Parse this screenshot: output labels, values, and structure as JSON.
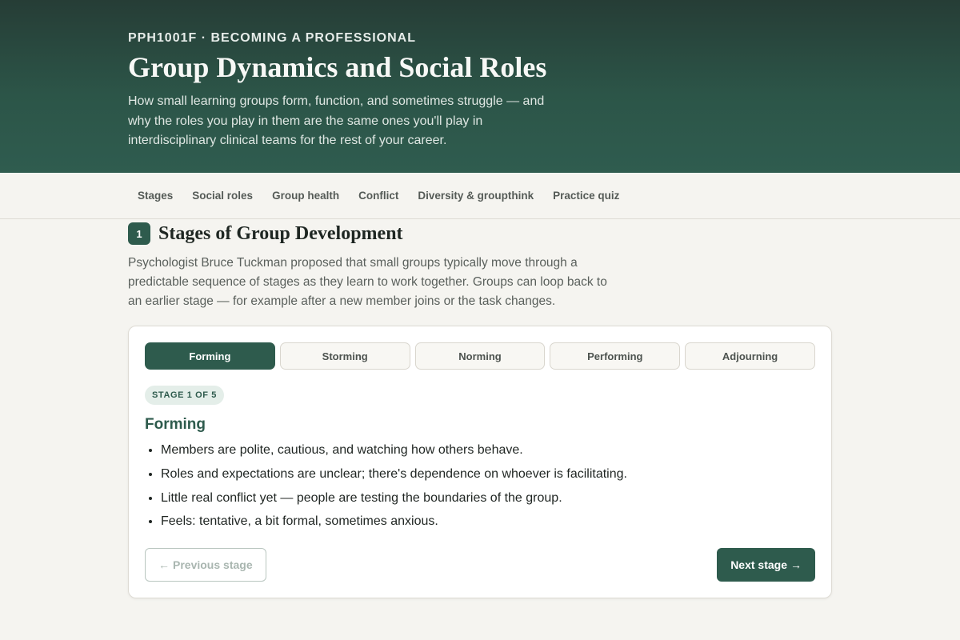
{
  "hero": {
    "course_code": "PPH1001F · BECOMING A PROFESSIONAL",
    "title": "Group Dynamics and Social Roles",
    "description": "How small learning groups form, function, and sometimes struggle — and why the roles you play in them are the same ones you'll play in interdisciplinary clinical teams for the rest of your career."
  },
  "nav": {
    "items": [
      "Stages",
      "Social roles",
      "Group health",
      "Conflict",
      "Diversity & groupthink",
      "Practice quiz"
    ]
  },
  "section": {
    "number": "1",
    "title": "Stages of Group Development",
    "description": "Psychologist Bruce Tuckman proposed that small groups typically move through a predictable sequence of stages as they learn to work together. Groups can loop back to an earlier stage — for example after a new member joins or the task changes."
  },
  "stage_tabs": [
    "Forming",
    "Storming",
    "Norming",
    "Performing",
    "Adjourning"
  ],
  "active_stage": {
    "badge": "STAGE 1 OF 5",
    "title": "Forming",
    "bullets": [
      "Members are polite, cautious, and watching how others behave.",
      "Roles and expectations are unclear; there's dependence on whoever is facilitating.",
      "Little real conflict yet — people are testing the boundaries of the group.",
      "Feels: tentative, a bit formal, sometimes anxious."
    ]
  },
  "buttons": {
    "prev_label": "Previous stage",
    "prev_icon": "←",
    "next_label": "Next stage",
    "next_icon": "→"
  },
  "colors": {
    "accent": "#2e5b4d",
    "hero_top": "#263d36",
    "background": "#f5f4f0"
  }
}
